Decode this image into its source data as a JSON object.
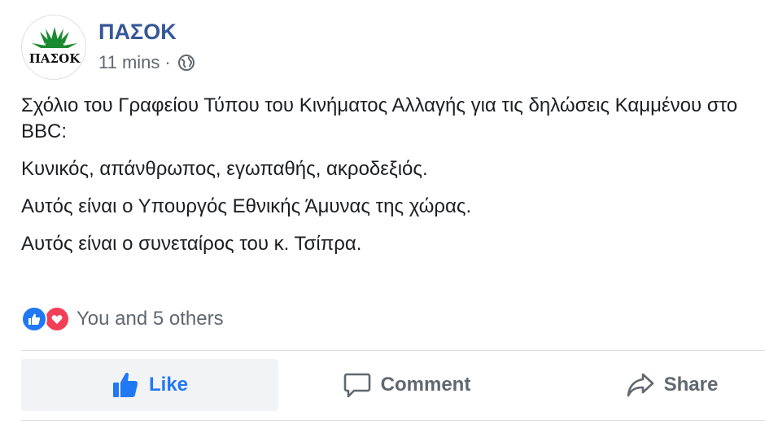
{
  "page": {
    "name": "ΠΑΣΟΚ",
    "timestamp": "11 mins",
    "separator": "·",
    "audience_icon": "globe-icon",
    "logo_text": "ΠΑΣΟΚ"
  },
  "post": {
    "paragraphs": [
      "Σχόλιο του Γραφείου Τύπου του Κινήματος Αλλαγής για τις δηλώσεις Καμμένου στο BBC:",
      "Κυνικός, απάνθρωπος, εγωπαθής, ακροδεξιός.",
      "Αυτός είναι ο Υπουργός Εθνικής Άμυνας της χώρας.",
      "Αυτός είναι ο συνεταίρος του κ. Τσίπρα."
    ]
  },
  "reactions": {
    "icons": [
      "like-reaction-icon",
      "love-reaction-icon"
    ],
    "summary": "You and 5 others"
  },
  "actions": {
    "like_label": "Like",
    "comment_label": "Comment",
    "share_label": "Share"
  },
  "colors": {
    "link_blue": "#365899",
    "like_blue": "#2078f4",
    "love_red": "#f33e58",
    "logo_green": "#1a8a2e"
  }
}
